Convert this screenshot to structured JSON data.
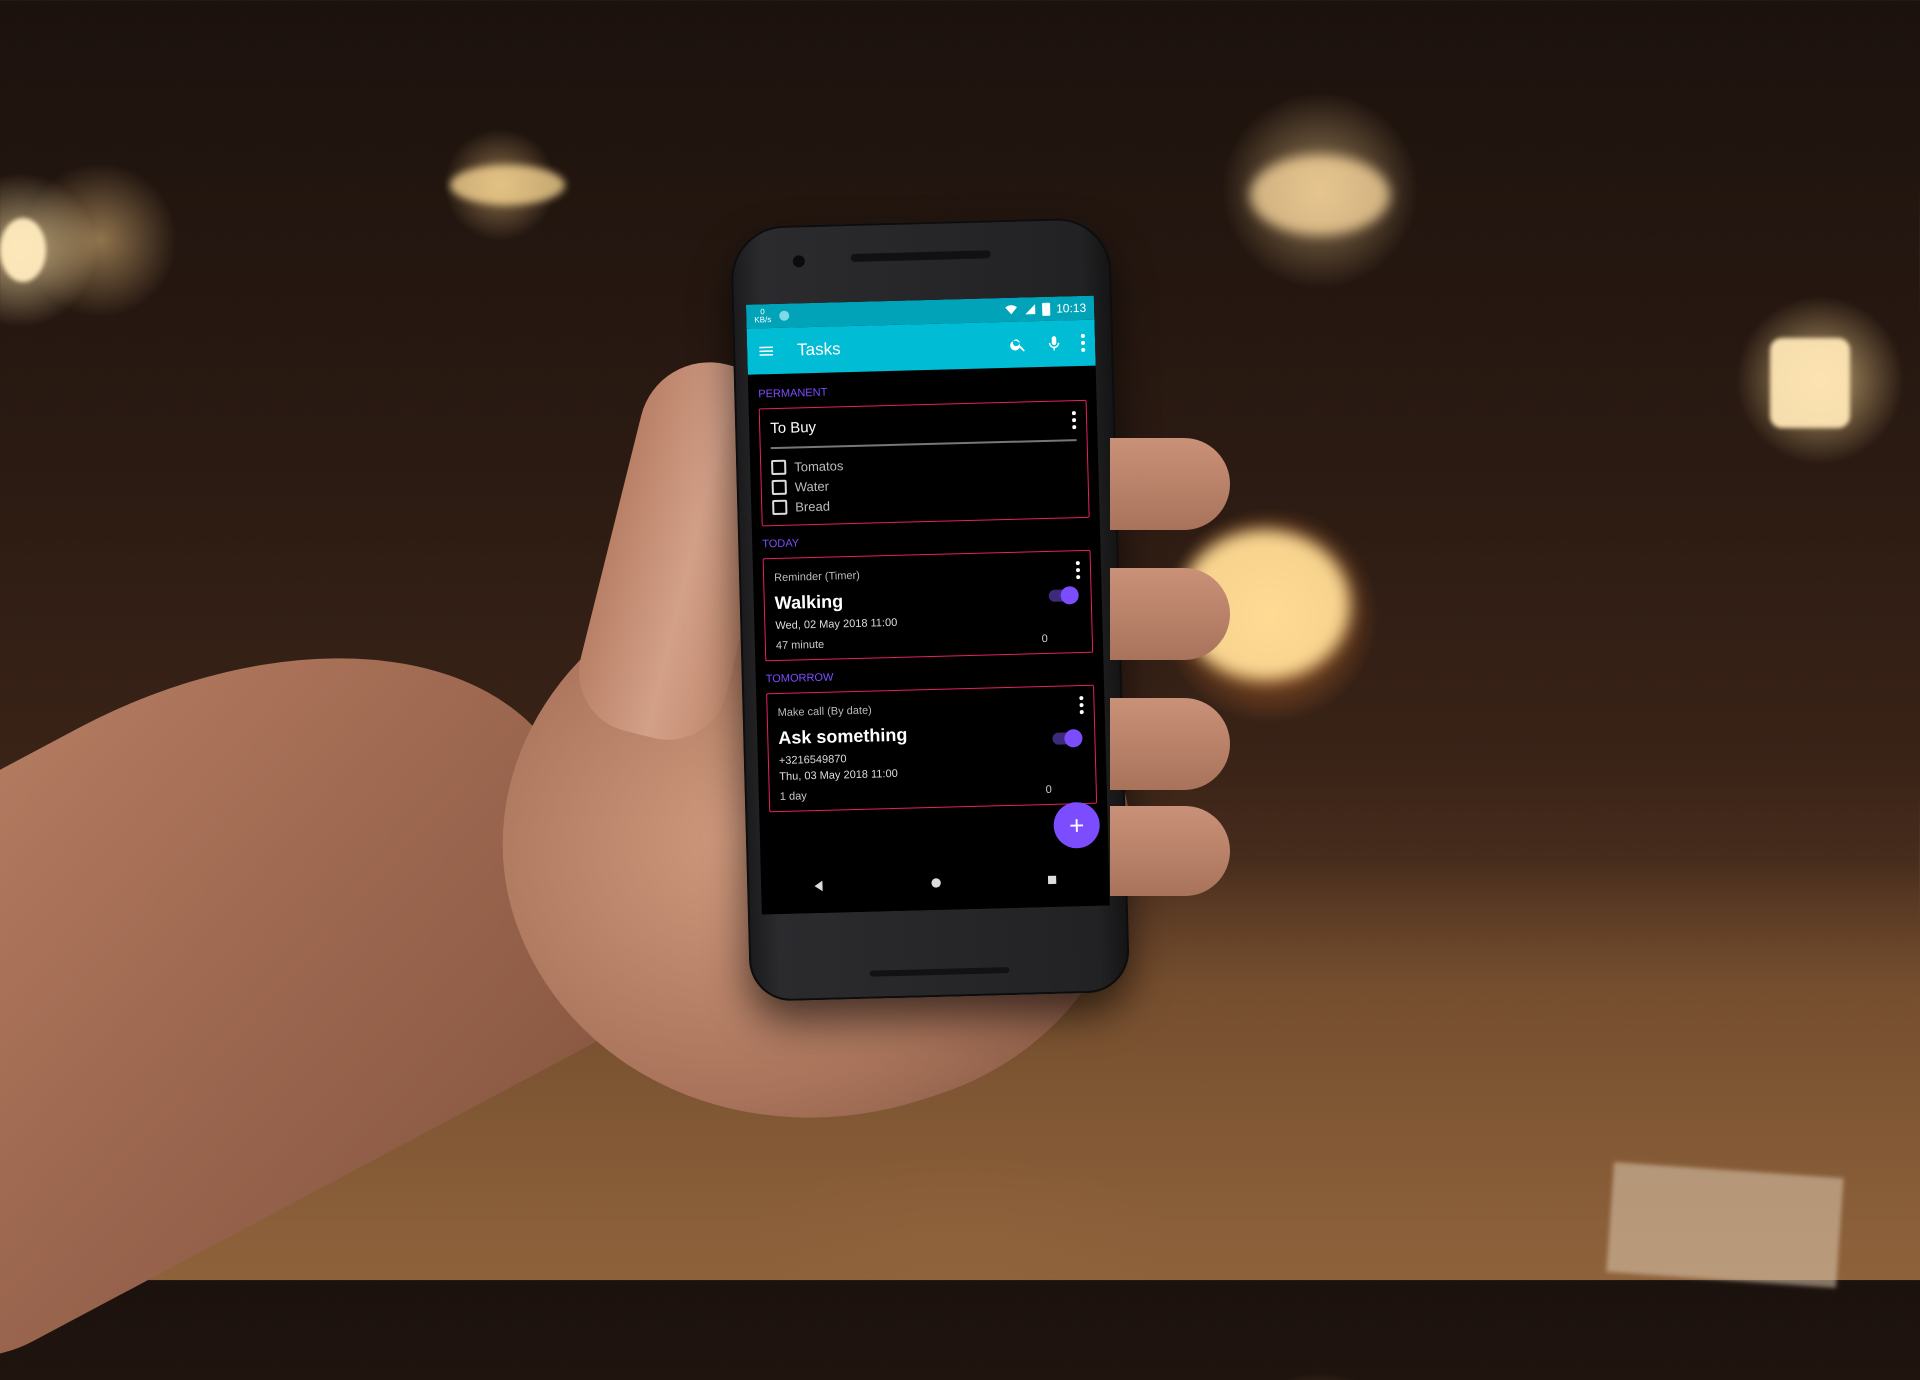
{
  "status_bar": {
    "speed_value": "0",
    "speed_unit": "KB/s",
    "time": "10:13"
  },
  "app_bar": {
    "title": "Tasks",
    "icons": [
      "menu-icon",
      "search-icon",
      "mic-icon",
      "more-vert-icon"
    ]
  },
  "sections": {
    "permanent": "PERMANENT",
    "today": "TODAY",
    "tomorrow": "TOMORROW"
  },
  "shopping_card": {
    "title": "To Buy",
    "items": [
      "Tomatos",
      "Water",
      "Bread"
    ]
  },
  "today_task": {
    "type": "Reminder (Timer)",
    "title": "Walking",
    "date": "Wed, 02 May 2018 11:00",
    "duration": "47 minute",
    "count": "0",
    "enabled": true
  },
  "tomorrow_task": {
    "type": "Make call (By date)",
    "title": "Ask something",
    "phone": "+3216549870",
    "date": "Thu, 03 May 2018 11:00",
    "duration": "1 day",
    "count": "0",
    "enabled": true
  },
  "fab": {
    "label": "+"
  },
  "colors": {
    "toolbar": "#00bcd4",
    "status_bar": "#00a3b8",
    "accent": "#7c4dff",
    "card_border": "#e91e63",
    "background": "#000000"
  }
}
